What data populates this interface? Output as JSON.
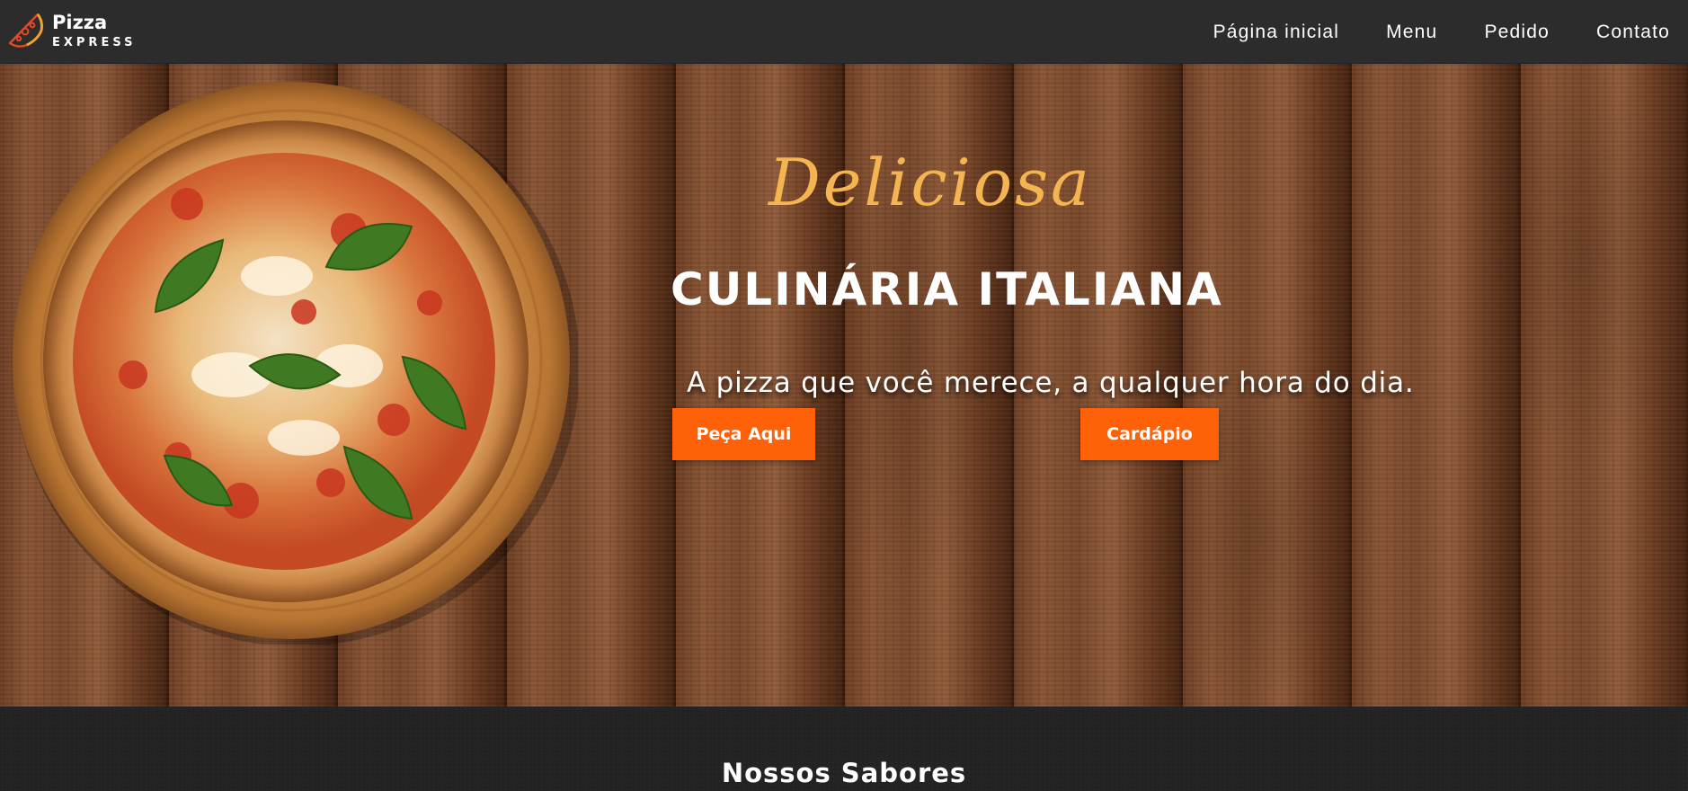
{
  "brand": {
    "name": "Pizza",
    "subtitle": "EXPRESS",
    "icon": "pizza-slice-icon"
  },
  "nav": {
    "items": [
      {
        "label": "Página inicial"
      },
      {
        "label": "Menu"
      },
      {
        "label": "Pedido"
      },
      {
        "label": "Contato"
      }
    ]
  },
  "hero": {
    "script_title": "Deliciosa",
    "title": "CULINÁRIA ITALIANA",
    "tagline": "A pizza que você merece, a qualquer hora do dia.",
    "order_button": "Peça Aqui",
    "menu_button": "Cardápio",
    "image": "margherita-pizza-on-wooden-board"
  },
  "flavors": {
    "title": "Nossos Sabores"
  },
  "colors": {
    "navbar": "#2c2c2c",
    "accent_orange": "#ff6109",
    "script_gold": "#f3b451",
    "section_dark": "#232323"
  }
}
